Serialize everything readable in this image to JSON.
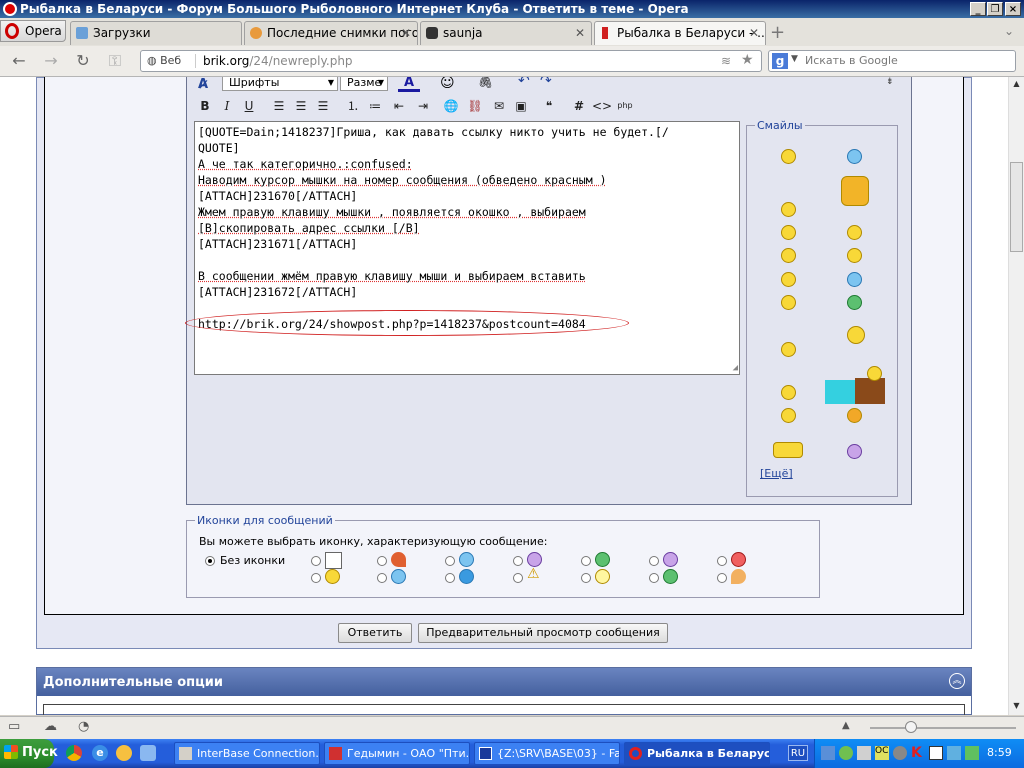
{
  "window": {
    "title": "Рыбалка в Беларуси - Форум Большого Рыболовного Интернет Клуба - Ответить в теме - Opera"
  },
  "opera_menu": {
    "label": "Opera"
  },
  "tabs": [
    {
      "label": "Загрузки"
    },
    {
      "label": "Последние снимки пого..."
    },
    {
      "label": "saunja"
    },
    {
      "label": "Рыбалка в Беларуси - ..."
    }
  ],
  "address": {
    "web_label": "Веб",
    "host": "brik.org",
    "path": "/24/newreply.php"
  },
  "search": {
    "placeholder": "Искать в Google",
    "engine": "g-icon"
  },
  "editor": {
    "font_select": "Шрифты",
    "size_select": "Разме",
    "lines": [
      "[QUOTE=Dain;1418237]Гриша, как давать ссылку никто учить не будет.[/",
      "QUOTE]",
      "А че так категорично.:confused:",
      "Наводим курсор мышки на номер сообщения (обведено красным )",
      "[ATTACH]231670[/ATTACH]",
      "Жмем правую клавишу мышки , появляется окошко , выбираем",
      "[B]скопировать адрес ссылки [/B]",
      "[ATTACH]231671[/ATTACH]",
      "",
      "В сообщении жмём правую клавишу мыши и выбираем вставить",
      "[ATTACH]231672[/ATTACH]",
      "",
      "http://brik.org/24/showpost.php?p=1418237&postcount=4084"
    ]
  },
  "smilies": {
    "legend": "Смайлы",
    "more": "[Ещё]"
  },
  "post_icons": {
    "legend": "Иконки для сообщений",
    "description": "Вы можете выбрать иконку, характеризующую сообщение:",
    "none_label": "Без иконки"
  },
  "buttons": {
    "reply": "Ответить",
    "preview": "Предварительный просмотр сообщения"
  },
  "extra_options": {
    "title": "Дополнительные опции"
  },
  "taskbar": {
    "start": "Пуск",
    "tasks": [
      {
        "label": "InterBase Connection..."
      },
      {
        "label": "Гедымин - ОАО \"Пти..."
      },
      {
        "label": "{Z:\\SRV\\BASE\\03} - Far"
      },
      {
        "label": "Рыбалка в Беларус..."
      }
    ],
    "lang": "RU",
    "clock": "8:59"
  }
}
